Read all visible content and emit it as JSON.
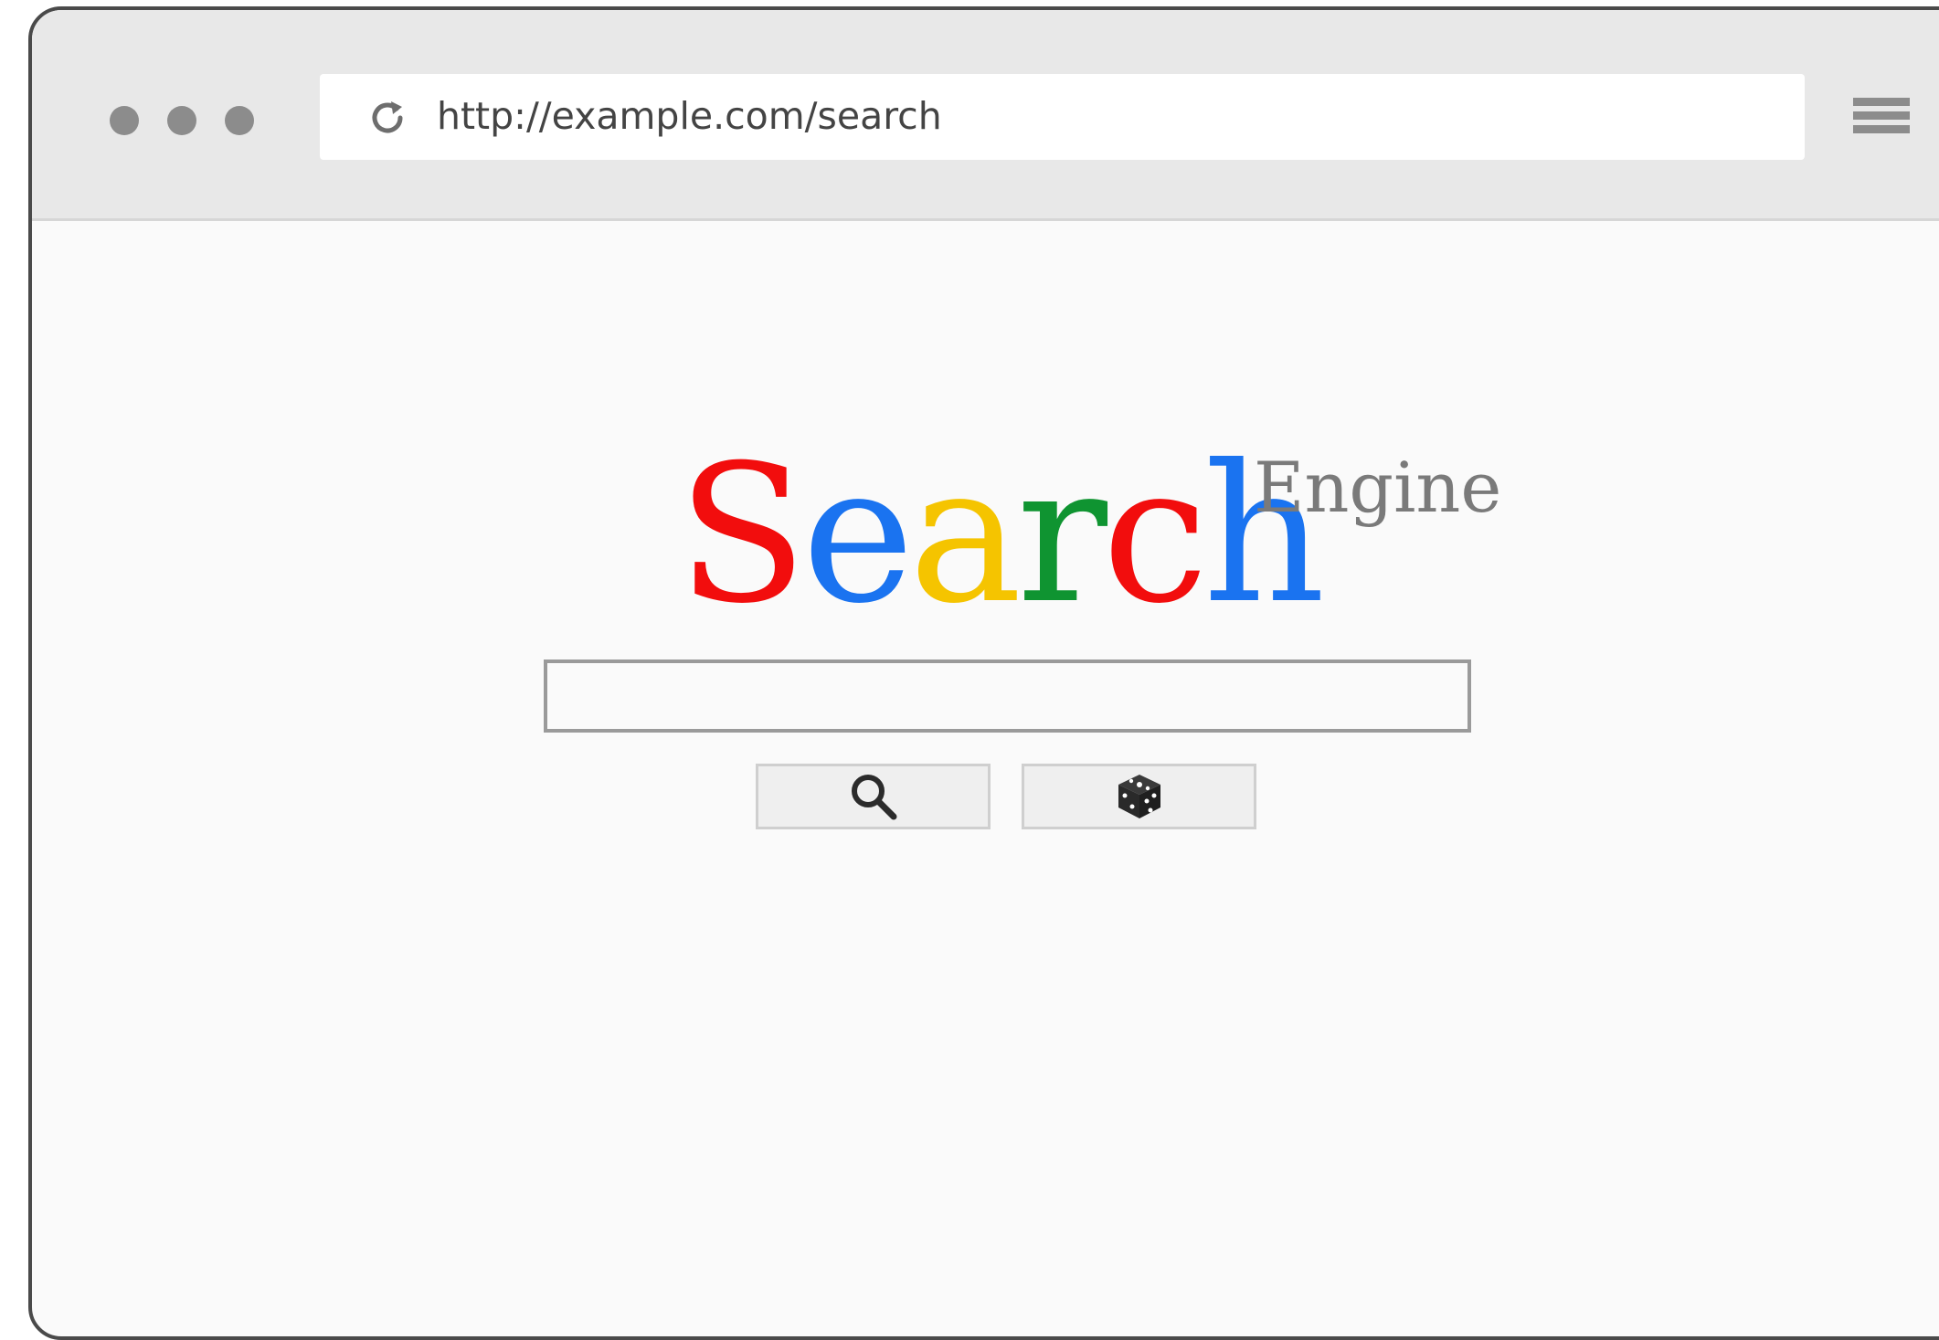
{
  "browser": {
    "url": "http://example.com/search",
    "reload_icon": "reload-icon",
    "menu_icon": "hamburger-menu-icon",
    "window_dots": [
      "window-dot",
      "window-dot",
      "window-dot"
    ]
  },
  "logo": {
    "letters": [
      {
        "char": "S",
        "color": "#f20d0d"
      },
      {
        "char": "e",
        "color": "#1a73f0"
      },
      {
        "char": "a",
        "color": "#f5c400"
      },
      {
        "char": "r",
        "color": "#0f9431"
      },
      {
        "char": "c",
        "color": "#f20d0d"
      },
      {
        "char": "h",
        "color": "#1a73f0"
      }
    ],
    "superscript": "Engine",
    "superscript_color": "#7a7a7a"
  },
  "search": {
    "value": "",
    "search_button_icon": "magnifier-icon",
    "lucky_button_icon": "dice-icon"
  },
  "colors": {
    "toolbar": "#e8e8e8",
    "page": "#fafafa",
    "frame": "#4a4a4a",
    "button": "#efefef"
  }
}
